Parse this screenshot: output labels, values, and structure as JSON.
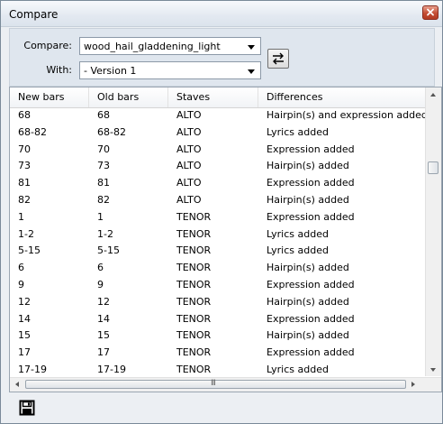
{
  "window": {
    "title": "Compare"
  },
  "compare": {
    "compare_label": "Compare:",
    "compare_value": "wood_hail_gladdening_light",
    "with_label": "With:",
    "with_value": "- Version 1"
  },
  "table": {
    "columns": [
      "New bars",
      "Old bars",
      "Staves",
      "Differences"
    ],
    "rows": [
      [
        "68",
        "68",
        "ALTO",
        "Hairpin(s) and expression added"
      ],
      [
        "68-82",
        "68-82",
        "ALTO",
        "Lyrics added"
      ],
      [
        "70",
        "70",
        "ALTO",
        "Expression added"
      ],
      [
        "73",
        "73",
        "ALTO",
        "Hairpin(s) added"
      ],
      [
        "81",
        "81",
        "ALTO",
        "Expression added"
      ],
      [
        "82",
        "82",
        "ALTO",
        "Hairpin(s) added"
      ],
      [
        "1",
        "1",
        "TENOR",
        "Expression added"
      ],
      [
        "1-2",
        "1-2",
        "TENOR",
        "Lyrics added"
      ],
      [
        "5-15",
        "5-15",
        "TENOR",
        "Lyrics added"
      ],
      [
        "6",
        "6",
        "TENOR",
        "Hairpin(s) added"
      ],
      [
        "9",
        "9",
        "TENOR",
        "Expression added"
      ],
      [
        "12",
        "12",
        "TENOR",
        "Hairpin(s) added"
      ],
      [
        "14",
        "14",
        "TENOR",
        "Expression added"
      ],
      [
        "15",
        "15",
        "TENOR",
        "Hairpin(s) added"
      ],
      [
        "17",
        "17",
        "TENOR",
        "Expression added"
      ],
      [
        "17-19",
        "17-19",
        "TENOR",
        "Lyrics added"
      ]
    ]
  },
  "scrollbar": {
    "grip": "III"
  },
  "icons": {
    "close": "close-icon",
    "swap": "swap-arrows-icon",
    "save": "save-icon"
  },
  "colors": {
    "close_button": "#c44c33",
    "panel": "#dfe6ee"
  }
}
